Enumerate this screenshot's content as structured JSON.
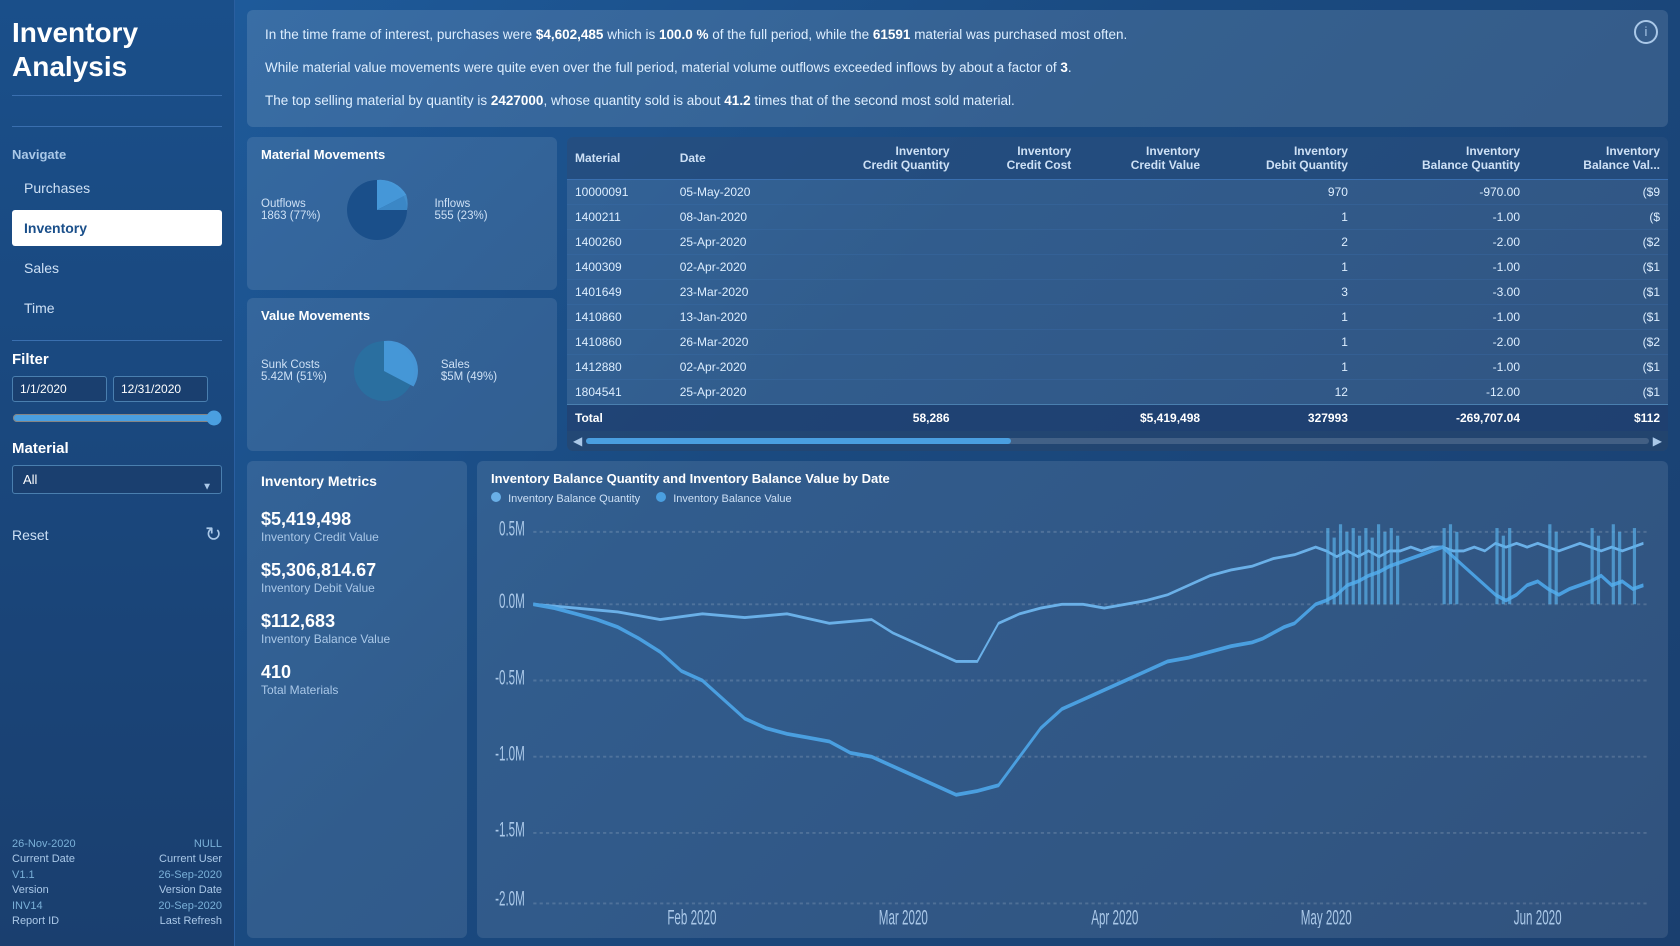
{
  "sidebar": {
    "title": "Inventory\nAnalysis",
    "navigate_label": "Navigate",
    "nav_items": [
      {
        "label": "Purchases",
        "active": false
      },
      {
        "label": "Inventory",
        "active": true
      },
      {
        "label": "Sales",
        "active": false
      },
      {
        "label": "Time",
        "active": false
      }
    ],
    "filter_label": "Filter",
    "date_start": "1/1/2020",
    "date_end": "12/31/2020",
    "material_label": "Material",
    "material_value": "All",
    "reset_label": "Reset",
    "footer": {
      "current_date_key": "Current Date",
      "current_date_val": "26-Nov-2020",
      "current_user_key": "Current User",
      "current_user_val": "NULL",
      "version_key": "Version",
      "version_val": "V1.1",
      "version_date_key": "Version Date",
      "version_date_val": "26-Sep-2020",
      "report_id_key": "Report ID",
      "report_id_val": "INV14",
      "last_refresh_key": "Last Refresh",
      "last_refresh_val": "20-Sep-2020"
    }
  },
  "infobox": {
    "line1_pre": "In the time frame of interest, purchases were ",
    "line1_bold1": "$4,602,485",
    "line1_mid": " which is ",
    "line1_bold2": "100.0 %",
    "line1_end": " of the full period, while the ",
    "line1_bold3": "61591",
    "line1_tail": " material was purchased most often.",
    "line2": "While material value movements were quite even over the full period, material volume outflows exceeded inflows by about a factor of ",
    "line2_bold": "3",
    "line2_end": ".",
    "line3_pre": "The top selling material by quantity is ",
    "line3_bold1": "2427000",
    "line3_mid": ", whose quantity sold is about ",
    "line3_bold2": "41.2",
    "line3_end": " times that of the second most sold material."
  },
  "material_movements": {
    "title": "Material Movements",
    "outflows_label": "Outflows",
    "outflows_value": "1863 (77%)",
    "inflows_label": "Inflows",
    "inflows_value": "555 (23%)",
    "outflows_pct": 77,
    "inflows_pct": 23
  },
  "value_movements": {
    "title": "Value Movements",
    "sunk_label": "Sunk Costs",
    "sunk_value": "5.42M (51%)",
    "sales_label": "Sales",
    "sales_value": "$5M (49%)",
    "sunk_pct": 51,
    "sales_pct": 49
  },
  "table": {
    "columns": [
      "Material",
      "Date",
      "Inventory Credit Quantity",
      "Inventory Credit Cost",
      "Inventory Credit Value",
      "Inventory Debit Quantity",
      "Inventory Balance Quantity",
      "Inventory Balance Value"
    ],
    "rows": [
      [
        "10000091",
        "05-May-2020",
        "",
        "",
        "",
        "970",
        "-970.00",
        "($9"
      ],
      [
        "1400211",
        "08-Jan-2020",
        "",
        "",
        "",
        "1",
        "-1.00",
        "($"
      ],
      [
        "1400260",
        "25-Apr-2020",
        "",
        "",
        "",
        "2",
        "-2.00",
        "($2"
      ],
      [
        "1400309",
        "02-Apr-2020",
        "",
        "",
        "",
        "1",
        "-1.00",
        "($1"
      ],
      [
        "1401649",
        "23-Mar-2020",
        "",
        "",
        "",
        "3",
        "-3.00",
        "($1"
      ],
      [
        "1410860",
        "13-Jan-2020",
        "",
        "",
        "",
        "1",
        "-1.00",
        "($1"
      ],
      [
        "1410860",
        "26-Mar-2020",
        "",
        "",
        "",
        "1",
        "-2.00",
        "($2"
      ],
      [
        "1412880",
        "02-Apr-2020",
        "",
        "",
        "",
        "1",
        "-1.00",
        "($1"
      ],
      [
        "1804541",
        "25-Apr-2020",
        "",
        "",
        "",
        "12",
        "-12.00",
        "($1"
      ]
    ],
    "footer": [
      "Total",
      "",
      "58,286",
      "",
      "$5,419,498",
      "327993",
      "-269,707.04",
      "$112"
    ]
  },
  "metrics": {
    "title": "Inventory Metrics",
    "items": [
      {
        "value": "$5,419,498",
        "label": "Inventory Credit Value"
      },
      {
        "value": "$5,306,814.67",
        "label": "Inventory Debit Value"
      },
      {
        "value": "$112,683",
        "label": "Inventory Balance Value"
      },
      {
        "value": "410",
        "label": "Total Materials"
      }
    ]
  },
  "line_chart": {
    "title": "Inventory Balance Quantity and Inventory Balance Value by Date",
    "legend": [
      {
        "label": "Inventory Balance Quantity",
        "color": "#6ab0e8"
      },
      {
        "label": "Inventory Balance Value",
        "color": "#4a7fbf"
      }
    ],
    "x_labels": [
      "Feb 2020",
      "Mar 2020",
      "Apr 2020",
      "May 2020",
      "Jun 2020"
    ],
    "y_labels": [
      "0.5M",
      "0.0M",
      "-0.5M",
      "-1.0M",
      "-1.5M",
      "-2.0M"
    ]
  }
}
